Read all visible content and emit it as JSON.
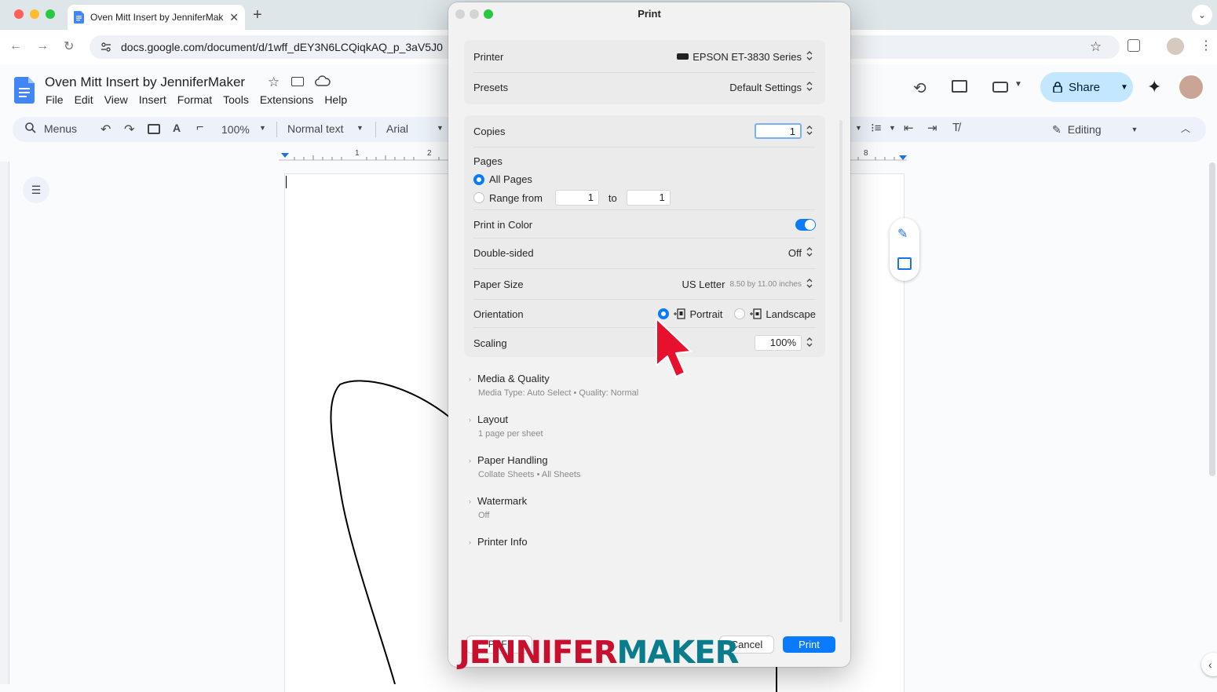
{
  "browser": {
    "tab_title": "Oven Mitt Insert by JenniferMaker",
    "url": "docs.google.com/document/d/1wff_dEY3N6LCQiqkAQ_p_3aV5J0",
    "traffic_colors": [
      "#ff5f57",
      "#febc2e",
      "#28c840"
    ]
  },
  "docs": {
    "title": "Oven Mitt Insert by JenniferMaker",
    "menu": [
      "File",
      "Edit",
      "View",
      "Insert",
      "Format",
      "Tools",
      "Extensions",
      "Help"
    ],
    "search_label": "Menus",
    "zoom": "100%",
    "style": "Normal text",
    "font": "Arial",
    "share_label": "Share",
    "editing_label": "Editing",
    "ruler_ticks": [
      "1",
      "2",
      "8"
    ]
  },
  "dialog": {
    "title": "Print",
    "printer_label": "Printer",
    "printer_value": "EPSON ET-3830 Series",
    "presets_label": "Presets",
    "presets_value": "Default Settings",
    "copies_label": "Copies",
    "copies_value": "1",
    "pages_label": "Pages",
    "all_pages_label": "All Pages",
    "range_from_label": "Range from",
    "range_from_value": "1",
    "range_to_label": "to",
    "range_to_value": "1",
    "color_label": "Print in Color",
    "color_on": true,
    "double_sided_label": "Double-sided",
    "double_sided_value": "Off",
    "paper_size_label": "Paper Size",
    "paper_size_value": "US Letter",
    "paper_size_dims": "8.50 by 11.00 inches",
    "orientation_label": "Orientation",
    "portrait_label": "Portrait",
    "landscape_label": "Landscape",
    "scaling_label": "Scaling",
    "scaling_value": "100%",
    "sections": [
      {
        "title": "Media & Quality",
        "subtitle": "Media Type: Auto Select • Quality: Normal"
      },
      {
        "title": "Layout",
        "subtitle": "1 page per sheet"
      },
      {
        "title": "Paper Handling",
        "subtitle": "Collate Sheets • All Sheets"
      },
      {
        "title": "Watermark",
        "subtitle": "Off"
      },
      {
        "title": "Printer Info",
        "subtitle": ""
      }
    ],
    "pdf_label": "PDF",
    "cancel_label": "Cancel",
    "print_label": "Print",
    "accent_color": "#0a7aff"
  },
  "watermark": {
    "part1": "JENNIFER",
    "part2": "MAKER",
    "color1": "#c8102e",
    "color2": "#0a7c8c"
  }
}
